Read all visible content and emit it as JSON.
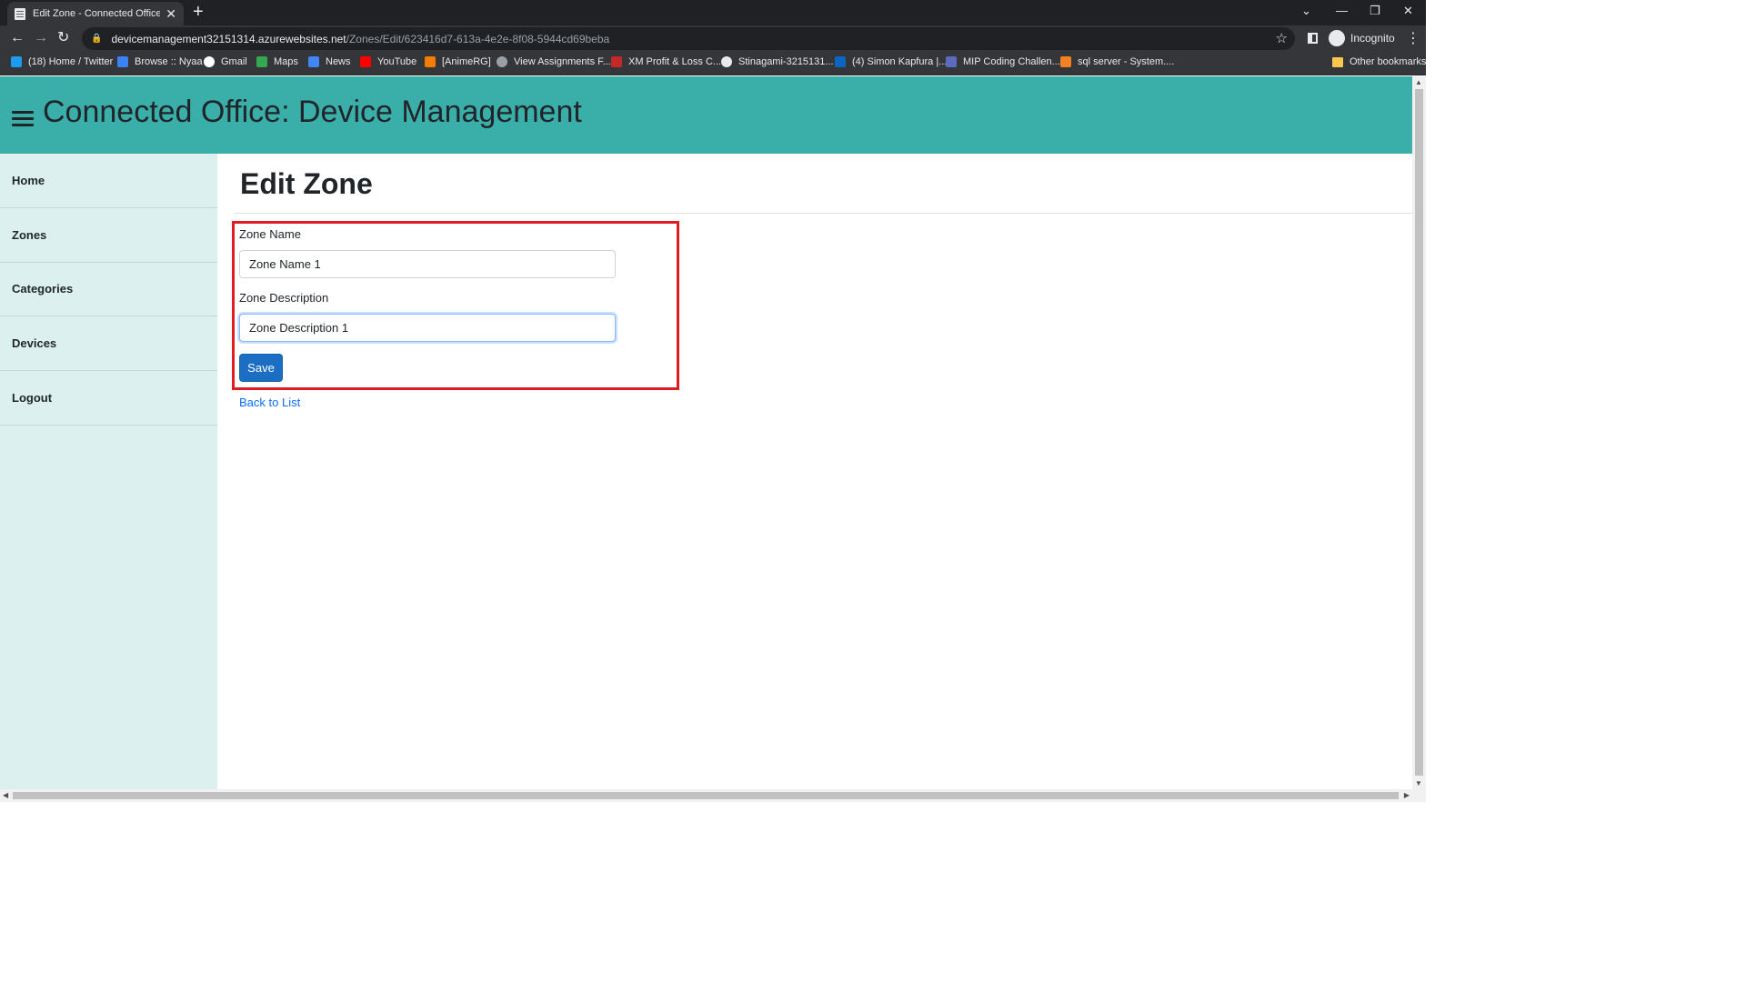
{
  "browser": {
    "tab_title": "Edit Zone - Connected Office: De",
    "new_tab_symbol": "+",
    "url_host": "devicemanagement32151314.azurewebsites.net",
    "url_path": "/Zones/Edit/623416d7-613a-4e2e-8f08-5944cd69beba",
    "profile_label": "Incognito",
    "bookmarks": [
      {
        "label": "(18) Home / Twitter",
        "icon": "twitter-icon",
        "color": "#1d9bf0"
      },
      {
        "label": "Browse :: Nyaa",
        "icon": "nyaa-icon",
        "color": "#3b82f6"
      },
      {
        "label": "Gmail",
        "icon": "google-icon",
        "color": "#ffffff"
      },
      {
        "label": "Maps",
        "icon": "maps-icon",
        "color": "#34a853"
      },
      {
        "label": "News",
        "icon": "news-icon",
        "color": "#4285f4"
      },
      {
        "label": "YouTube",
        "icon": "youtube-icon",
        "color": "#ff0000"
      },
      {
        "label": "[AnimeRG]",
        "icon": "blogger-icon",
        "color": "#f57c00"
      },
      {
        "label": "View Assignments F...",
        "icon": "globe-icon",
        "color": "#9aa0a6"
      },
      {
        "label": "XM Profit & Loss C...",
        "icon": "xm-icon",
        "color": "#c62828"
      },
      {
        "label": "Stinagami-3215131...",
        "icon": "github-icon",
        "color": "#e8eaed"
      },
      {
        "label": "(4) Simon Kapfura |...",
        "icon": "linkedin-icon",
        "color": "#0a66c2"
      },
      {
        "label": "MIP Coding Challen...",
        "icon": "mip-icon",
        "color": "#5c6bc0"
      },
      {
        "label": "sql server - System....",
        "icon": "stackoverflow-icon",
        "color": "#f48024"
      }
    ],
    "other_bookmarks": "Other bookmarks"
  },
  "app": {
    "title": "Connected Office: Device Management",
    "header_color": "#3aaea9"
  },
  "sidebar": {
    "items": [
      {
        "label": "Home"
      },
      {
        "label": "Zones"
      },
      {
        "label": "Categories"
      },
      {
        "label": "Devices"
      },
      {
        "label": "Logout"
      }
    ]
  },
  "main": {
    "page_title": "Edit Zone",
    "form": {
      "name_label": "Zone Name",
      "name_value": "Zone Name 1",
      "description_label": "Zone Description",
      "description_value": "Zone Description 1",
      "save_label": "Save"
    },
    "back_link": "Back to List"
  },
  "colors": {
    "highlight_border": "#e01b24",
    "primary_button": "#1b6ec2",
    "link": "#0d6efd",
    "sidebar_bg": "#dcf1ef"
  }
}
